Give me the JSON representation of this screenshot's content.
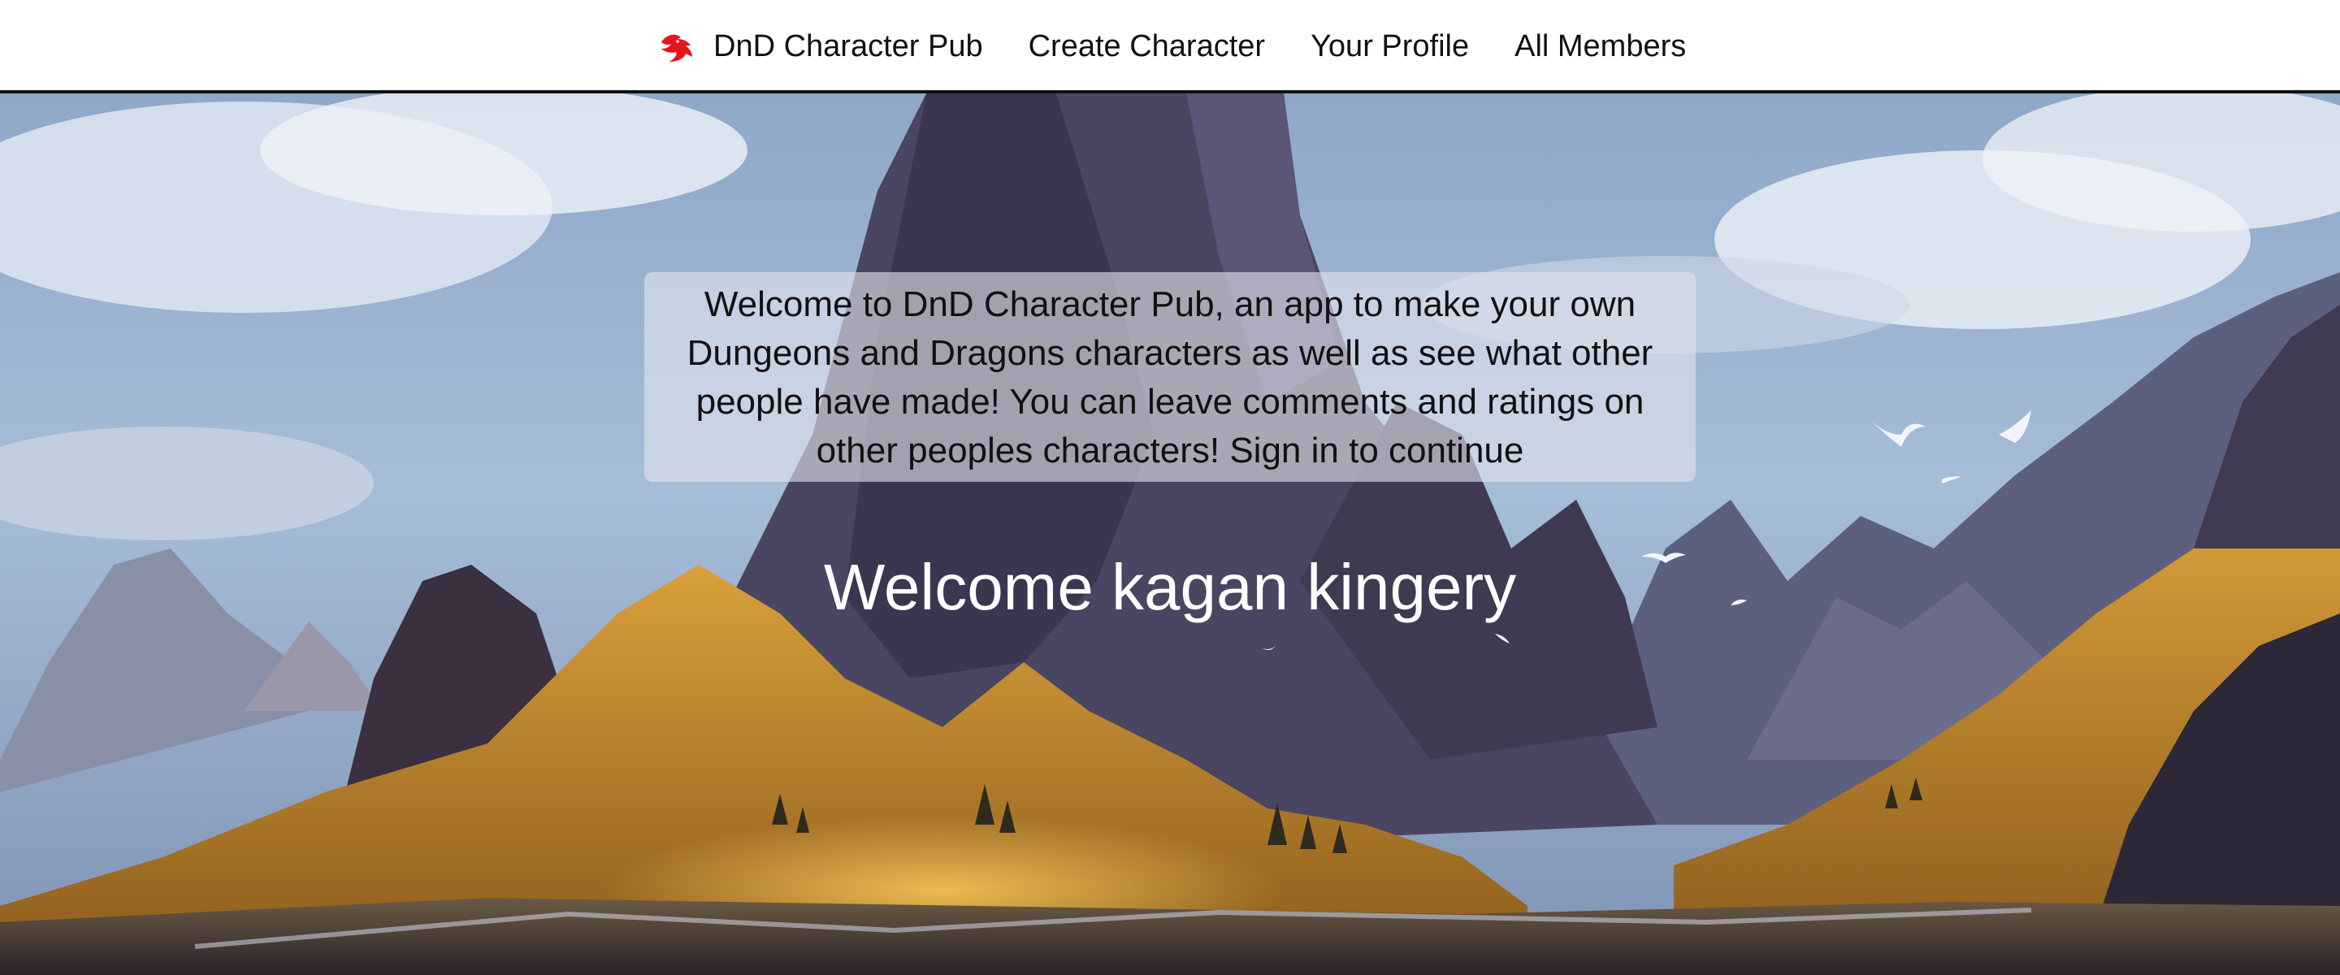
{
  "navbar": {
    "brand_icon": "dragon-icon",
    "brand_label": "DnD Character Pub",
    "links": [
      {
        "label": "Create Character"
      },
      {
        "label": "Your Profile"
      },
      {
        "label": "All Members"
      }
    ],
    "accent_color": "#e8141b"
  },
  "hero": {
    "intro_text": "Welcome to DnD Character Pub, an app to make your own Dungeons and Dragons characters as well as see what other people have made! You can leave comments and ratings on other peoples characters! Sign in to continue",
    "welcome_prefix": "Welcome",
    "user_name": "kagan kingery"
  }
}
